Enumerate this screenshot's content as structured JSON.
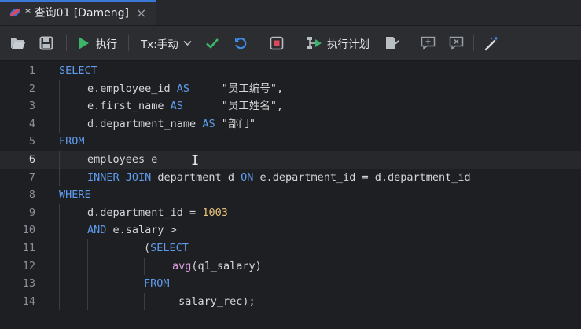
{
  "tab": {
    "title": "* 查询01 [Dameng]",
    "close": "×"
  },
  "toolbar": {
    "execute_label": "执行",
    "tx_mode_label": "Tx:手动",
    "plan_label": "执行计划"
  },
  "editor": {
    "lines": [
      {
        "n": "1",
        "indent": 0,
        "tokens": [
          [
            "kw",
            "SELECT"
          ]
        ]
      },
      {
        "n": "2",
        "indent": 1,
        "tokens": [
          [
            "t",
            "e.employee_id "
          ],
          [
            "kw",
            "AS"
          ],
          [
            "t",
            "     "
          ],
          [
            "str",
            "\"员工编号\""
          ],
          [
            "t",
            ","
          ]
        ]
      },
      {
        "n": "3",
        "indent": 1,
        "tokens": [
          [
            "t",
            "e.first_name "
          ],
          [
            "kw",
            "AS"
          ],
          [
            "t",
            "      "
          ],
          [
            "str",
            "\"员工姓名\""
          ],
          [
            "t",
            ","
          ]
        ]
      },
      {
        "n": "4",
        "indent": 1,
        "tokens": [
          [
            "t",
            "d.department_name "
          ],
          [
            "kw",
            "AS"
          ],
          [
            "t",
            " "
          ],
          [
            "str",
            "\"部门\""
          ]
        ]
      },
      {
        "n": "5",
        "indent": 0,
        "tokens": [
          [
            "kw",
            "FROM"
          ]
        ]
      },
      {
        "n": "6",
        "indent": 1,
        "tokens": [
          [
            "t",
            "employees e"
          ]
        ],
        "current": true
      },
      {
        "n": "7",
        "indent": 1,
        "tokens": [
          [
            "kw",
            "INNER JOIN"
          ],
          [
            "t",
            " department d "
          ],
          [
            "kw",
            "ON"
          ],
          [
            "t",
            " e.department_id = d.department_id"
          ]
        ]
      },
      {
        "n": "8",
        "indent": 0,
        "tokens": [
          [
            "kw",
            "WHERE"
          ]
        ]
      },
      {
        "n": "9",
        "indent": 1,
        "tokens": [
          [
            "t",
            "d.department_id = "
          ],
          [
            "num",
            "1003"
          ]
        ]
      },
      {
        "n": "10",
        "indent": 1,
        "tokens": [
          [
            "kw",
            "AND"
          ],
          [
            "t",
            " e.salary >"
          ]
        ]
      },
      {
        "n": "11",
        "indent": 3,
        "tokens": [
          [
            "t",
            "("
          ],
          [
            "kw",
            "SELECT"
          ]
        ]
      },
      {
        "n": "12",
        "indent": 4,
        "tokens": [
          [
            "fn",
            "avg"
          ],
          [
            "t",
            "(q1_salary)"
          ]
        ]
      },
      {
        "n": "13",
        "indent": 3,
        "tokens": [
          [
            "kw",
            "FROM"
          ]
        ]
      },
      {
        "n": "14",
        "indent": 4,
        "tokens": [
          [
            "t",
            " salary_rec);"
          ]
        ]
      }
    ]
  },
  "colors": {
    "keyword": "#5f9ced",
    "number": "#e8c07d",
    "function": "#d99ad9",
    "accent": "#3a77d6"
  }
}
